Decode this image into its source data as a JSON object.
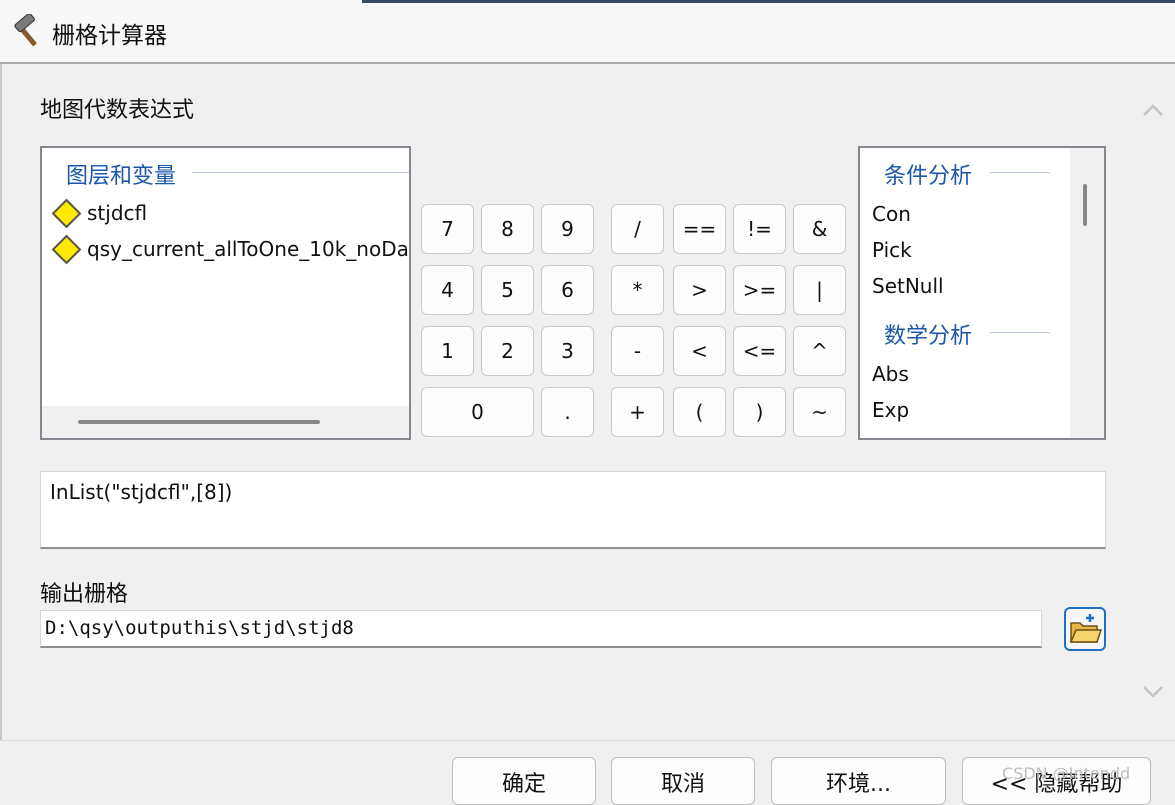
{
  "window": {
    "title": "栅格计算器",
    "icon": "hammer-icon"
  },
  "expression_section": {
    "label": "地图代数表达式"
  },
  "layers_panel": {
    "header": "图层和变量",
    "items": [
      "stjdcfl",
      "qsy_current_allToOne_10k_noDa"
    ]
  },
  "calculator": {
    "rows": [
      [
        "7",
        "8",
        "9",
        "/",
        "==",
        "!=",
        "&"
      ],
      [
        "4",
        "5",
        "6",
        "*",
        ">",
        ">=",
        "|"
      ],
      [
        "1",
        "2",
        "3",
        "-",
        "<",
        "<=",
        "^"
      ],
      [
        "0",
        ".",
        "+",
        "(",
        ")",
        "~"
      ]
    ]
  },
  "functions_panel": {
    "groups": [
      {
        "header": "条件分析",
        "items": [
          "Con",
          "Pick",
          "SetNull"
        ]
      },
      {
        "header": "数学分析",
        "items": [
          "Abs",
          "Exp"
        ]
      }
    ]
  },
  "expression": {
    "value": "InList(\"stjdcfl\",[8])"
  },
  "output": {
    "label": "输出栅格",
    "value": "D:\\qsy\\outputhis\\stjd\\stjd8"
  },
  "footer": {
    "ok_label": "确定",
    "cancel_label": "取消",
    "env_label": "环境...",
    "hide_help_label": "<< 隐藏帮助"
  },
  "watermark": "CSDN @Intendd",
  "colors": {
    "group_header": "#1b57a8",
    "diamond_fill": "#ffea00",
    "browse_border": "#1f6fc7"
  }
}
